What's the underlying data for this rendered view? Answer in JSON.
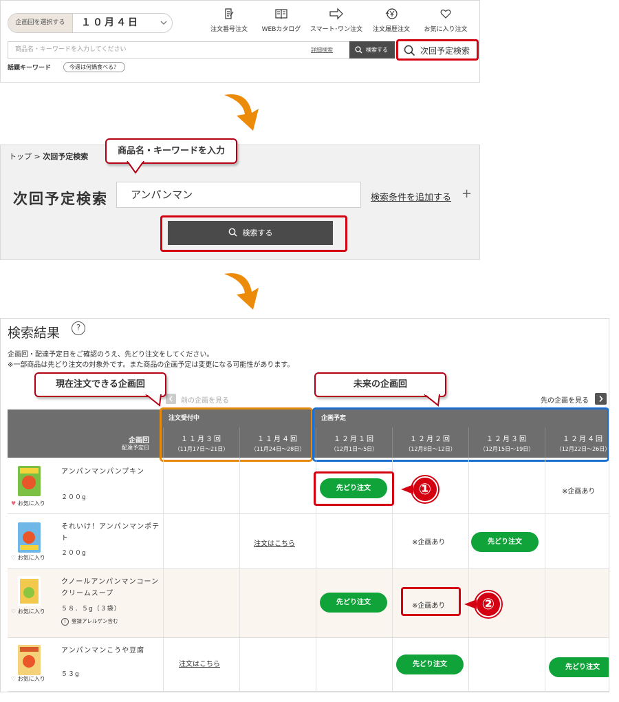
{
  "header": {
    "kaikai_label": "企画回を選択する",
    "kaikai_value": "１０月４日",
    "nav": [
      {
        "label": "注文番号注文",
        "icon": "pencil-doc-icon"
      },
      {
        "label": "WEBカタログ",
        "icon": "book-icon"
      },
      {
        "label": "スマート･ワン注文",
        "icon": "arrow-right-icon"
      },
      {
        "label": "注文履歴注文",
        "icon": "yen-history-icon"
      },
      {
        "label": "お気に入り注文",
        "icon": "heart-icon"
      }
    ],
    "search_placeholder": "商品名・キーワードを入力してください",
    "advanced": "詳細検索",
    "search_button": "検索する",
    "next_search": "次回予定検索",
    "hot_label": "話題キーワード",
    "hot_pill": "今週は何鍋食べる？"
  },
  "panel2": {
    "crumb_top": "トップ",
    "crumb_sep": " > ",
    "crumb_current": "次回予定検索",
    "callout": "商品名・キーワードを入力",
    "title": "次回予定検索",
    "input_value": "アンパンマン",
    "add_condition": "検索条件を追加する",
    "plus": "+",
    "search_button": "検索する"
  },
  "results": {
    "title": "検索結果",
    "help": "?",
    "note1": "企画回・配達予定日をご確認のうえ、先どり注文をしてください。",
    "note2": "※一部商品は先どり注文の対象外です。また商品の企画予定は変更になる可能性があります。",
    "callout_current": "現在注文できる企画回",
    "callout_future": "未来の企画回",
    "prev_link": "前の企画を見る",
    "next_link": "先の企画を見る",
    "group_current": "注文受付中",
    "group_future": "企画予定",
    "left_head1": "企画回",
    "left_head2": "配達予定日",
    "columns": [
      {
        "kai": "１１月３回",
        "date": "（11月17日～21日）"
      },
      {
        "kai": "１１月４回",
        "date": "（11月24日～28日）"
      },
      {
        "kai": "１２月１回",
        "date": "（12月1日～5日）"
      },
      {
        "kai": "１２月２回",
        "date": "（12月8日～12日）"
      },
      {
        "kai": "１２月３回",
        "date": "（12月15日～19日）"
      },
      {
        "kai": "１２月４回",
        "date": "（12月22日～26日）"
      }
    ],
    "fav_label": "お気に入り",
    "order_here": "注文はこちら",
    "preorder": "先どり注文",
    "planned": "※企画あり",
    "allergen": "登録アレルゲン含む",
    "products": [
      {
        "name": "アンパンマンパンプキン",
        "size": "２００g"
      },
      {
        "name": "それいけ！アンパンマンポテト",
        "size": "２００g"
      },
      {
        "name": "クノールアンパンマンコーンクリームスープ",
        "size": "５８．５g（３袋）"
      },
      {
        "name": "アンパンマンこうや豆腐",
        "size": "５３g"
      }
    ],
    "num1": "①",
    "num2": "②"
  },
  "colors": {
    "highlight_red": "#d40011",
    "green": "#0fa33a",
    "current_orange": "#e58a0f",
    "future_blue": "#1a6fd1",
    "arrow_orange": "#ec8a0a"
  }
}
